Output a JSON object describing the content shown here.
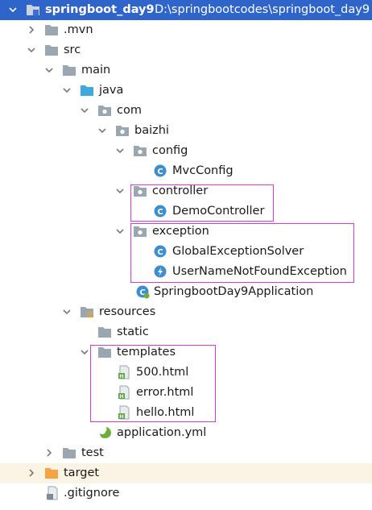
{
  "tree": {
    "project": {
      "name": "springboot_day9",
      "path": "D:\\springbootcodes\\springboot_day9"
    },
    "mvn": ".mvn",
    "src": "src",
    "main": "main",
    "java": "java",
    "com": "com",
    "baizhi": "baizhi",
    "config": "config",
    "mvcconfig": "MvcConfig",
    "controller": "controller",
    "democontroller": "DemoController",
    "exception": "exception",
    "globalexceptionsolver": "GlobalExceptionSolver",
    "usernamenotfoundexception": "UserNameNotFoundException",
    "application_class": "SpringbootDay9Application",
    "resources": "resources",
    "static": "static",
    "templates": "templates",
    "file500": "500.html",
    "error": "error.html",
    "hello": "hello.html",
    "application_yml": "application.yml",
    "test": "test",
    "target": "target",
    "gitignore": ".gitignore"
  },
  "colors": {
    "selection": "#2f65ca",
    "highlight_box": "#d63bd6",
    "excluded_row": "#fbf3e3",
    "folder_gray": "#9aa7b0",
    "folder_blue": "#40a9dc",
    "folder_orange": "#f4a444",
    "class_icon": "#3d8ecf",
    "exception_icon": "#3d8ecf",
    "spring_green": "#6cae3e"
  },
  "icons": [
    "chevron-down-icon",
    "chevron-right-icon",
    "module-folder-icon",
    "folder-icon",
    "source-folder-icon",
    "package-icon",
    "class-icon",
    "exception-class-icon",
    "spring-boot-class-icon",
    "resources-folder-icon",
    "html-file-icon",
    "yml-file-icon",
    "excluded-folder-icon",
    "gitignore-file-icon"
  ]
}
